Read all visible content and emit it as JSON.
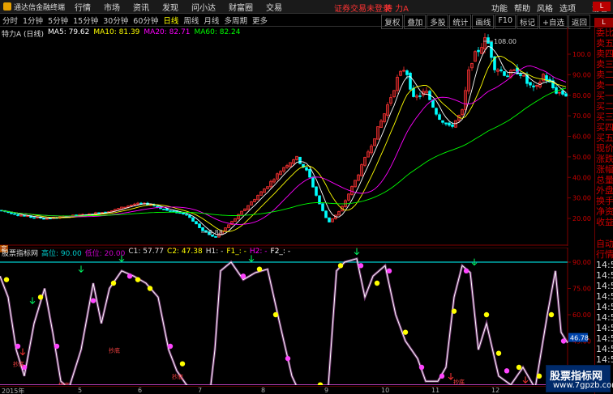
{
  "menubar": {
    "app_name": "通达信金融终端",
    "items": [
      "行情",
      "市场",
      "资讯",
      "发现",
      "问小达",
      "财富圈",
      "交易"
    ],
    "login_status": "证券交易未登录",
    "stock_name": "特 力A",
    "right_items": [
      "功能",
      "帮助",
      "风格",
      "选项"
    ],
    "guest": "游客"
  },
  "periodbar": {
    "periods": [
      "分时",
      "1分钟",
      "5分钟",
      "15分钟",
      "30分钟",
      "60分钟",
      "日线",
      "周线",
      "月线",
      "多周期",
      "更多"
    ],
    "active": "日线",
    "tools": [
      "复权",
      "叠加",
      "多股",
      "统计",
      "画线",
      "F10",
      "标记",
      "+自选",
      "返回"
    ]
  },
  "main_legend": {
    "stock": "特力A (日线)",
    "ma5": "MA5: 79.62",
    "ma10": "MA10: 81.39",
    "ma20": "MA20: 82.71",
    "ma60": "MA60: 82.24"
  },
  "main_chart": {
    "y_ticks": [
      "100.0",
      "90.00",
      "80.00",
      "70.00",
      "60.00",
      "50.00",
      "40.00",
      "30.00",
      "20.00"
    ],
    "high_label": "108.00",
    "low_label": "9.88",
    "colors": {
      "up": "#ff3333",
      "down": "#00ffff",
      "ma5": "#ffffff",
      "ma10": "#ffff00",
      "ma20": "#ff00ff",
      "ma60": "#00ff00"
    }
  },
  "sub_legend": {
    "name": "股票指标网",
    "high": "高位: 90.00",
    "low": "低位: 20.00",
    "c1": "C1: 57.77",
    "c2": "C2: 47.38",
    "h1": "H1: -",
    "f1": "F1_: -",
    "h2": "H2: -",
    "f2": "F2_: -"
  },
  "sub_chart": {
    "y_ticks": [
      "90.00",
      "75.00",
      "60.00",
      "45.00",
      "30.00"
    ],
    "current_value": "46.78",
    "buy_label": "买",
    "bottom_label": "抄底"
  },
  "datebar": {
    "labels": [
      "2015年",
      "5",
      "6",
      "7",
      "8",
      "9",
      "10",
      "11",
      "12"
    ]
  },
  "right_panel": {
    "badge": "L 8000",
    "items": [
      "委比",
      "卖五",
      "卖四",
      "卖三",
      "卖二",
      "卖一",
      "买一",
      "买二",
      "买三",
      "买四",
      "买五",
      "现价",
      "涨跌",
      "涨幅",
      "总量",
      "外盘",
      "换手",
      "净资",
      "收益"
    ],
    "lower_items": [
      "自动",
      "行情",
      "14:5",
      "14:5",
      "14:5",
      "14:5",
      "14:5",
      "14:5",
      "14:5",
      "14:5",
      "14:5",
      "14:5"
    ]
  },
  "watermark": {
    "line1": "股票指标网",
    "line2": "www.7gpzb.com"
  }
}
